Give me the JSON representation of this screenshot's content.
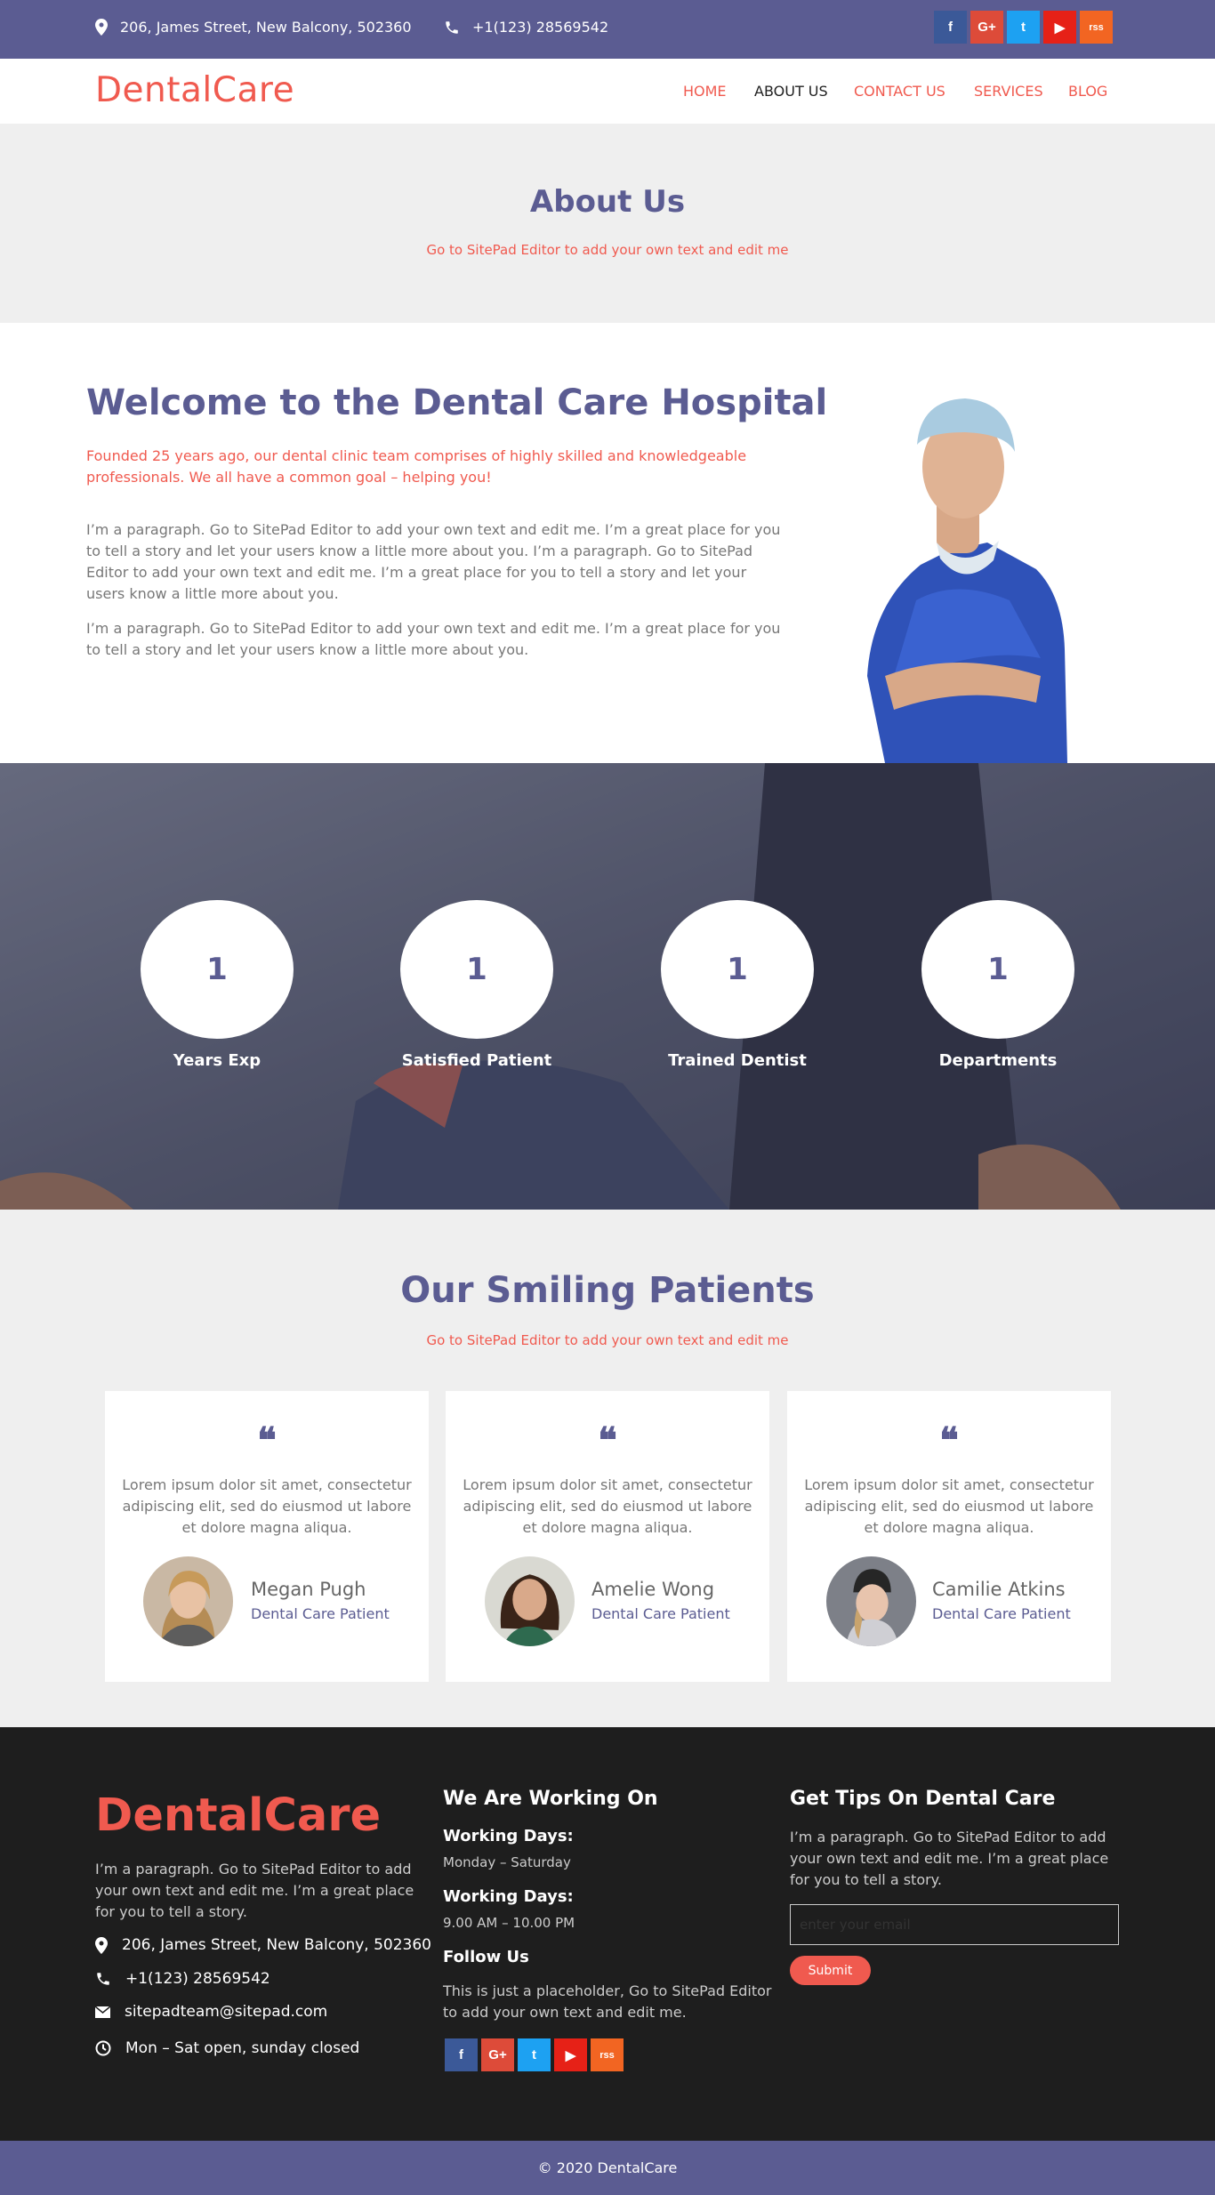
{
  "topbar": {
    "address": "206, James Street, New Balcony, 502360",
    "phone": "+1(123) 28569542",
    "social": [
      "f",
      "G+",
      "t",
      "▶",
      "rss"
    ]
  },
  "header": {
    "logo": "DentalCare",
    "nav": [
      "HOME",
      "ABOUT US",
      "CONTACT US",
      "SERVICES",
      "BLOG"
    ],
    "active": "ABOUT US"
  },
  "hero": {
    "title": "About Us",
    "subtitle": "Go to SitePad Editor to add your own text and edit me"
  },
  "welcome": {
    "title": "Welcome to the Dental Care Hospital",
    "lead": "Founded 25 years ago, our dental clinic team comprises of highly skilled and knowledgeable professionals. We all have a common goal – helping you!",
    "p1": "I’m a paragraph. Go to SitePad Editor to add your own text and edit me. I’m a great place for you to tell a story and let your users know a little more about you. I’m a paragraph. Go to SitePad Editor to add your own text and edit me. I’m a great place for you to tell a story and let your users know a little more about you.",
    "p2": "I’m a paragraph. Go to SitePad Editor to add your own text and edit me. I’m a great place for you to tell a story and let your users know a little more about you."
  },
  "stats": [
    {
      "value": "1",
      "label": "Years Exp"
    },
    {
      "value": "1",
      "label": "Satisfied Patient"
    },
    {
      "value": "1",
      "label": "Trained Dentist"
    },
    {
      "value": "1",
      "label": "Departments"
    }
  ],
  "patients": {
    "title": "Our Smiling Patients",
    "subtitle": "Go to SitePad Editor to add your own text and edit me",
    "items": [
      {
        "text": "Lorem ipsum dolor sit amet, consectetur adipiscing elit, sed do eiusmod ut labore et dolore magna aliqua.",
        "name": "Megan Pugh",
        "role": "Dental Care Patient"
      },
      {
        "text": "Lorem ipsum dolor sit amet, consectetur adipiscing elit, sed do eiusmod ut labore et dolore magna aliqua.",
        "name": "Amelie Wong",
        "role": "Dental Care Patient"
      },
      {
        "text": "Lorem ipsum dolor sit amet, consectetur adipiscing elit, sed do eiusmod ut labore et dolore magna aliqua.",
        "name": "Camilie Atkins",
        "role": "Dental Care Patient"
      }
    ]
  },
  "footer": {
    "logo": "DentalCare",
    "about": "I’m a paragraph. Go to SitePad Editor to add your own text and edit me. I’m a great place for you to tell a story.",
    "address": "206, James Street, New Balcony, 502360",
    "phone": "+1(123) 28569542",
    "email": "sitepadteam@sitepad.com",
    "hours": "Mon – Sat open, sunday closed",
    "working_title": "We Are Working On",
    "days_label": "Working Days:",
    "days_value": "Monday – Saturday",
    "hours_label": "Working Days:",
    "hours_value": "9.00 AM – 10.00 PM",
    "follow_title": "Follow Us",
    "follow_text": "This is just a placeholder, Go to SitePad Editor to add your own text and edit me.",
    "tips_title": "Get Tips On Dental Care",
    "tips_text": "I’m a paragraph. Go to SitePad Editor to add your own text and edit me. I’m a great place for you to tell a story.",
    "email_placeholder": "enter your email",
    "submit_label": "Submit"
  },
  "copyright": "© 2020 DentalCare",
  "colors": {
    "primary": "#5b5c92",
    "accent": "#f05a4f",
    "footer_bg": "#1e1e1e",
    "light_bg": "#efefef"
  }
}
